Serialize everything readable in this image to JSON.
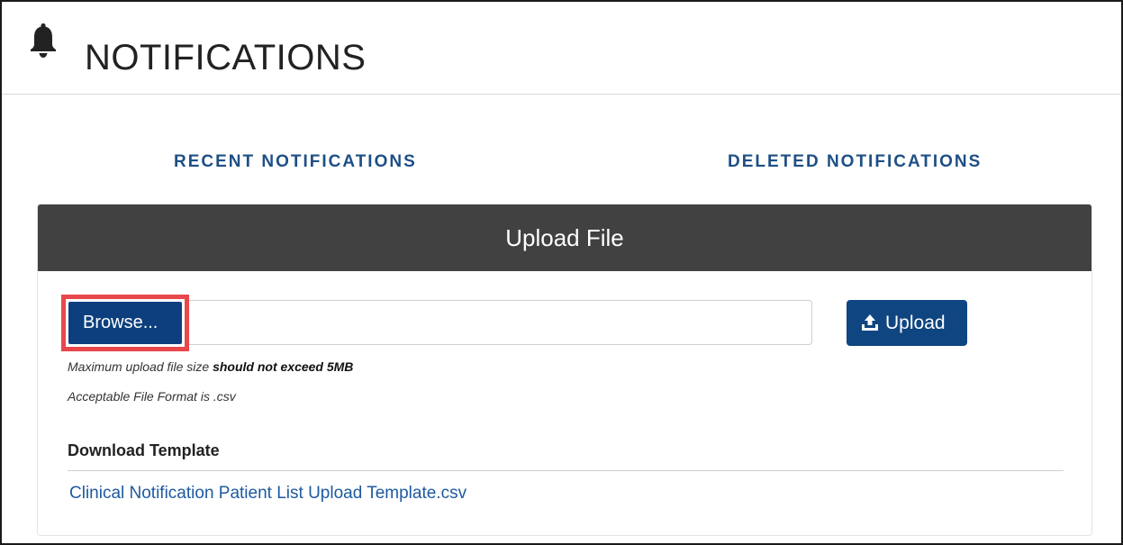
{
  "header": {
    "title": "NOTIFICATIONS",
    "icon": "bell-icon"
  },
  "tabs": [
    {
      "label": "RECENT NOTIFICATIONS"
    },
    {
      "label": "DELETED NOTIFICATIONS"
    }
  ],
  "upload_card": {
    "title": "Upload File",
    "browse_label": "Browse...",
    "file_value": "",
    "upload_label": "Upload",
    "upload_icon": "upload-icon",
    "hint_size_prefix": "Maximum upload file size ",
    "hint_size_emphasis": "should not exceed 5MB",
    "hint_format": "Acceptable File Format is .csv",
    "download_title": "Download Template",
    "template_link": "Clinical Notification Patient List Upload Template.csv"
  },
  "colors": {
    "accent": "#0d3f7e",
    "tab_text": "#1e4f86",
    "card_header_bg": "#414141",
    "highlight": "#e8474b",
    "link": "#1e5aa0"
  }
}
